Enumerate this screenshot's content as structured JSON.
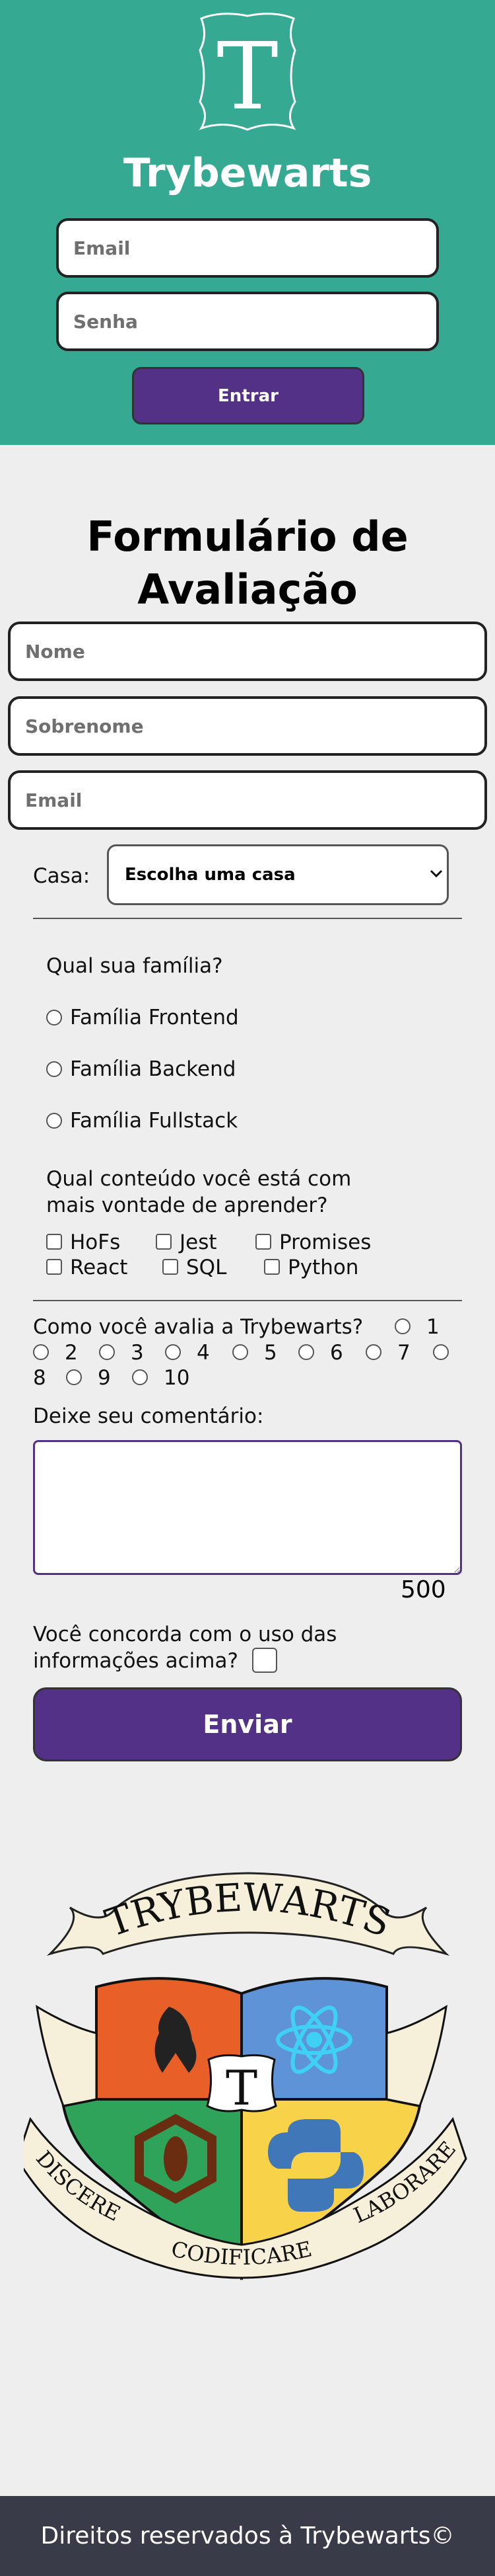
{
  "header": {
    "logo_letter": "T",
    "brand": "Trybewarts",
    "email_placeholder": "Email",
    "password_placeholder": "Senha",
    "login_button": "Entrar"
  },
  "form": {
    "title_line1": "Formulário de",
    "title_line2": "Avaliação",
    "name_placeholder": "Nome",
    "lastname_placeholder": "Sobrenome",
    "email_placeholder": "Email",
    "house_label": "Casa:",
    "house_selected": "Escolha uma casa",
    "family_question": "Qual sua família?",
    "families": [
      "Família Frontend",
      "Família Backend",
      "Família Fullstack"
    ],
    "content_question_line1": "Qual conteúdo você está com",
    "content_question_line2": "mais vontade de aprender?",
    "subjects": [
      "HoFs",
      "Jest",
      "Promises",
      "React",
      "SQL",
      "Python"
    ],
    "rating_question": "Como você avalia a Trybewarts?",
    "ratings": [
      "1",
      "2",
      "3",
      "4",
      "5",
      "6",
      "7",
      "8",
      "9",
      "10"
    ],
    "comment_label": "Deixe seu comentário:",
    "char_counter": "500",
    "agreement_line1": "Você concorda com o uso das",
    "agreement_line2": "informações acima?",
    "submit_button": "Enviar"
  },
  "crest": {
    "banner_text": "TRYBEWARTS",
    "center_letter": "T",
    "motto_left": "DISCERE",
    "motto_center": "CODIFICARE",
    "motto_right": "LABORARE"
  },
  "footer": {
    "text": "Direitos reservados à Trybewarts©"
  },
  "colors": {
    "header_bg": "#36a993",
    "button_purple": "#533187",
    "page_bg": "#eeeeee",
    "footer_bg": "#393b48"
  }
}
